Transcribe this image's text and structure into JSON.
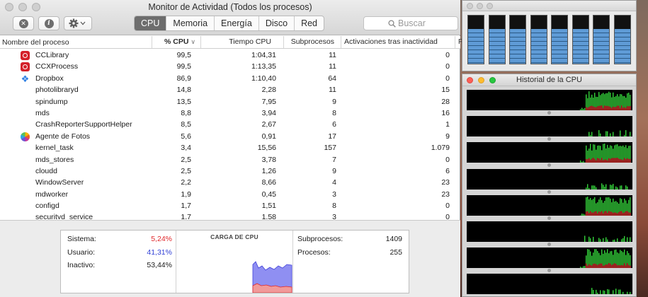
{
  "window": {
    "title": "Monitor de Actividad (Todos los procesos)"
  },
  "toolbar": {
    "stop_icon": "x-circle-icon",
    "info_icon": "info-icon",
    "action_icon": "gear-icon",
    "tabs": [
      "CPU",
      "Memoria",
      "Energía",
      "Disco",
      "Red"
    ],
    "active_tab": "CPU",
    "search_placeholder": "Buscar"
  },
  "table": {
    "columns": [
      "Nombre del proceso",
      "% CPU",
      "Tiempo CPU",
      "Subprocesos",
      "Activaciones tras inactividad",
      "P"
    ],
    "sort_indicator": "∨",
    "rows": [
      {
        "name": "CCLibrary",
        "cpu": "99,5",
        "time": "1:04,31",
        "threads": "11",
        "wakes": "0",
        "icon": "creative-cloud"
      },
      {
        "name": "CCXProcess",
        "cpu": "99,5",
        "time": "1:13,35",
        "threads": "11",
        "wakes": "0",
        "icon": "creative-cloud"
      },
      {
        "name": "Dropbox",
        "cpu": "86,9",
        "time": "1:10,40",
        "threads": "64",
        "wakes": "0",
        "icon": "dropbox"
      },
      {
        "name": "photolibraryd",
        "cpu": "14,8",
        "time": "2,28",
        "threads": "11",
        "wakes": "15",
        "icon": ""
      },
      {
        "name": "spindump",
        "cpu": "13,5",
        "time": "7,95",
        "threads": "9",
        "wakes": "28",
        "icon": ""
      },
      {
        "name": "mds",
        "cpu": "8,8",
        "time": "3,94",
        "threads": "8",
        "wakes": "16",
        "icon": ""
      },
      {
        "name": "CrashReporterSupportHelper",
        "cpu": "8,5",
        "time": "2,67",
        "threads": "6",
        "wakes": "1",
        "icon": ""
      },
      {
        "name": "Agente de Fotos",
        "cpu": "5,6",
        "time": "0,91",
        "threads": "17",
        "wakes": "9",
        "icon": "photos"
      },
      {
        "name": "kernel_task",
        "cpu": "3,4",
        "time": "15,56",
        "threads": "157",
        "wakes": "1.079",
        "icon": ""
      },
      {
        "name": "mds_stores",
        "cpu": "2,5",
        "time": "3,78",
        "threads": "7",
        "wakes": "0",
        "icon": ""
      },
      {
        "name": "cloudd",
        "cpu": "2,5",
        "time": "1,26",
        "threads": "9",
        "wakes": "6",
        "icon": ""
      },
      {
        "name": "WindowServer",
        "cpu": "2,2",
        "time": "8,66",
        "threads": "4",
        "wakes": "23",
        "icon": ""
      },
      {
        "name": "mdworker",
        "cpu": "1,9",
        "time": "0,45",
        "threads": "3",
        "wakes": "23",
        "icon": ""
      },
      {
        "name": "configd",
        "cpu": "1,7",
        "time": "1,51",
        "threads": "8",
        "wakes": "0",
        "icon": ""
      },
      {
        "name": "securityd_service",
        "cpu": "1,7",
        "time": "1,58",
        "threads": "3",
        "wakes": "0",
        "icon": ""
      }
    ]
  },
  "summary": {
    "system_label": "Sistema:",
    "system_value": "5,24%",
    "system_color": "#e0282b",
    "user_label": "Usuario:",
    "user_value": "41,31%",
    "user_color": "#2f3fd6",
    "idle_label": "Inactivo:",
    "idle_value": "53,44%",
    "load_title": "CARGA DE CPU",
    "threads_label": "Subprocesos:",
    "threads_value": "1409",
    "processes_label": "Procesos:",
    "processes_value": "255"
  },
  "cpu_usage_window": {
    "core_levels": [
      0.72,
      0.72,
      0.72,
      0.72,
      0.72,
      0.72,
      0.72,
      0.72
    ],
    "fill_color": "#5f9bd6"
  },
  "cpu_history_window": {
    "title": "Historial de la CPU",
    "user_color": "#34d23a",
    "system_color": "#d9262b"
  }
}
